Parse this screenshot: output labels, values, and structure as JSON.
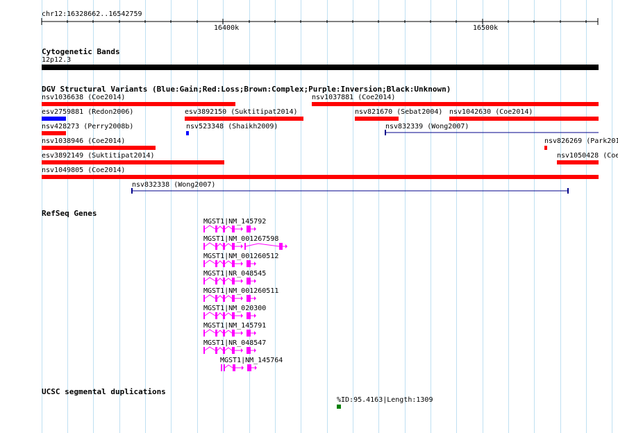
{
  "region": "chr12:16328662..16542759",
  "ruler": {
    "tick_labels": [
      "16400k",
      "16500k"
    ]
  },
  "tracks": {
    "cytoband": {
      "title": "Cytogenetic Bands",
      "band": "12p12.3"
    },
    "dgv": {
      "title": "DGV Structural Variants (Blue:Gain;Red:Loss;Brown:Complex;Purple:Inversion;Black:Unknown)",
      "features": [
        {
          "label": "nsv1036638 (Coe2014)"
        },
        {
          "label": "nsv1037881 (Coe2014)"
        },
        {
          "label": "esv2759881 (Redon2006)"
        },
        {
          "label": "esv3892150 (Suktitipat2014)"
        },
        {
          "label": "nsv821670 (Sebat2004)"
        },
        {
          "label": "nsv1042630 (Coe2014)"
        },
        {
          "label": "nsv428273 (Perry2008b)"
        },
        {
          "label": "nsv523348 (Shaikh2009)"
        },
        {
          "label": "nsv832339 (Wong2007)"
        },
        {
          "label": "nsv1038946 (Coe2014)"
        },
        {
          "label": "nsv826269 (Park201"
        },
        {
          "label": "esv3892149 (Suktitipat2014)"
        },
        {
          "label": "nsv1050428 (Coe"
        },
        {
          "label": "nsv1049805 (Coe2014)"
        },
        {
          "label": "nsv832338 (Wong2007)"
        }
      ]
    },
    "refseq": {
      "title": "RefSeq Genes",
      "genes": [
        {
          "label": "MGST1|NM_145792"
        },
        {
          "label": "MGST1|NM_001267598"
        },
        {
          "label": "MGST1|NM_001260512"
        },
        {
          "label": "MGST1|NR_048545"
        },
        {
          "label": "MGST1|NM_001260511"
        },
        {
          "label": "MGST1|NM_020300"
        },
        {
          "label": "MGST1|NM_145791"
        },
        {
          "label": "MGST1|NR_048547"
        },
        {
          "label": "MGST1|NM_145764"
        }
      ]
    },
    "segdup": {
      "title": "UCSC segmental duplications",
      "feature_label": "%ID:95.4163|Length:1309"
    }
  },
  "colors": {
    "gain": "#0000ff",
    "loss": "#ff0000",
    "line_feature": "#00008b",
    "gene": "#ff00ff",
    "segdup": "#008000",
    "grid": "#bfe0f2",
    "cytoband": "#000000"
  }
}
